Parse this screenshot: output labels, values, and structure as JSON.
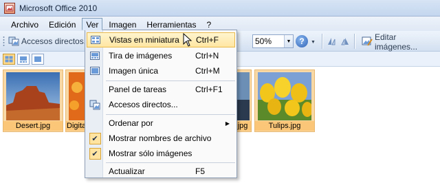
{
  "window": {
    "title": "Microsoft Office 2010"
  },
  "menubar": {
    "items": [
      {
        "label": "Archivo"
      },
      {
        "label": "Edición"
      },
      {
        "label": "Ver"
      },
      {
        "label": "Imagen"
      },
      {
        "label": "Herramientas"
      },
      {
        "label": "?"
      }
    ]
  },
  "toolbar": {
    "shortcuts_label": "Accesos directos...",
    "zoom_value": "50%",
    "help_label": "?",
    "edit_images_label": "Editar imágenes..."
  },
  "thumbnails": [
    {
      "caption": "Desert.jpg"
    },
    {
      "caption": "Digita"
    },
    {
      "caption": "jpg"
    },
    {
      "caption": "Tulips.jpg"
    }
  ],
  "view_menu": {
    "items": [
      {
        "label": "Vistas en miniatura",
        "shortcut": "Ctrl+F",
        "icon": "thumbnails-view-icon",
        "highlighted": true
      },
      {
        "label": "Tira de imágenes",
        "shortcut": "Ctrl+N",
        "icon": "filmstrip-view-icon"
      },
      {
        "label": "Imagen única",
        "shortcut": "Ctrl+M",
        "icon": "single-image-view-icon"
      },
      {
        "label": "Panel de tareas",
        "shortcut": "Ctrl+F1"
      },
      {
        "label": "Accesos directos...",
        "shortcut": "",
        "icon": "shortcuts-icon"
      },
      {
        "label": "Ordenar por",
        "shortcut": "",
        "submenu_arrow": "▶"
      },
      {
        "label": "Mostrar nombres de archivo",
        "shortcut": "",
        "checked": true
      },
      {
        "label": "Mostrar sólo imágenes",
        "shortcut": "",
        "checked": true
      },
      {
        "label": "Actualizar",
        "shortcut": "F5"
      }
    ]
  },
  "colors": {
    "highlight": "#ffe6a2",
    "thumb_bg": "#f8d9a6",
    "menubar_bg": "#dfe8f5"
  }
}
